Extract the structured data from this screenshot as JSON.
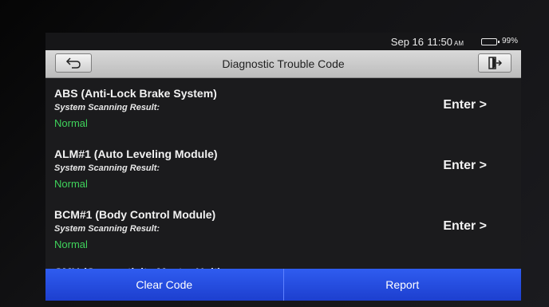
{
  "status": {
    "date": "Sep 16",
    "time": "11:50",
    "ampm": "AM",
    "battery": "99%"
  },
  "header": {
    "title": "Diagnostic Trouble Code",
    "back_icon": "back-arrow-icon",
    "exit_icon": "exit-icon"
  },
  "systems": [
    {
      "name": "ABS (Anti-Lock Brake System)",
      "subtitle": "System Scanning Result:",
      "status": "Normal",
      "action": "Enter >"
    },
    {
      "name": "ALM#1 (Auto Leveling Module)",
      "subtitle": "System Scanning Result:",
      "status": "Normal",
      "action": "Enter >"
    },
    {
      "name": "BCM#1 (Body Control Module)",
      "subtitle": "System Scanning Result:",
      "status": "Normal",
      "action": "Enter >"
    },
    {
      "name": "CMU (Connectivity Master Unit)"
    }
  ],
  "footer": {
    "clear_label": "Clear Code",
    "report_label": "Report"
  },
  "colors": {
    "normal": "#3fd25b",
    "button_blue": "#2f5cf0"
  }
}
